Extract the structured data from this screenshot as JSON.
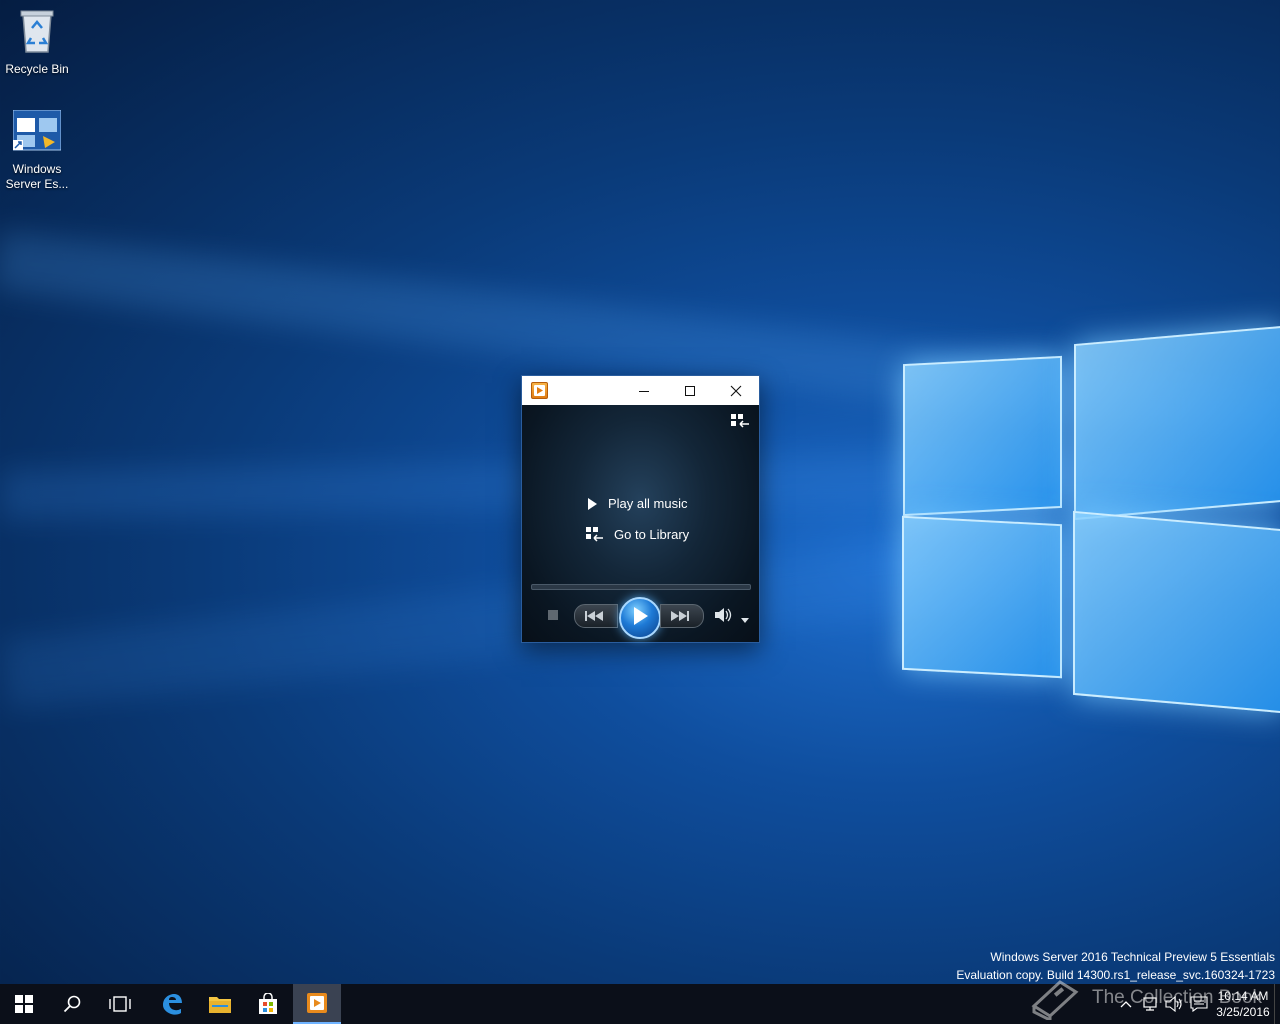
{
  "desktop": {
    "icons": [
      {
        "label": "Recycle Bin",
        "icon": "recycle-bin-icon"
      },
      {
        "label": "Windows Server Es...",
        "label_line1": "Windows",
        "label_line2": "Server Es...",
        "icon": "windows-server-essentials-icon"
      }
    ],
    "watermark": {
      "line1": "Windows Server 2016 Technical Preview 5 Essentials",
      "line2": "Evaluation copy. Build 14300.rs1_release_svc.160324-1723"
    },
    "overlay_text": "The Collection Book"
  },
  "wmp": {
    "app_icon": "windows-media-player-icon",
    "titlebar_buttons": [
      "minimize",
      "maximize",
      "close"
    ],
    "play_all_label": "Play all music",
    "go_to_library_label": "Go to Library",
    "controls": [
      "stop",
      "previous",
      "play",
      "next",
      "mute",
      "volume"
    ]
  },
  "taskbar": {
    "items": [
      "start-button",
      "search-button",
      "task-view-button",
      "edge",
      "file-explorer",
      "store",
      "windows-media-player"
    ],
    "active": "windows-media-player",
    "clock": {
      "time": "10:14 AM",
      "date": "3/25/2016"
    }
  },
  "colors": {
    "accent": "#3c8fe0",
    "taskbar_bg": "#0b0f19",
    "desktop_bg": "#0a3a78"
  }
}
